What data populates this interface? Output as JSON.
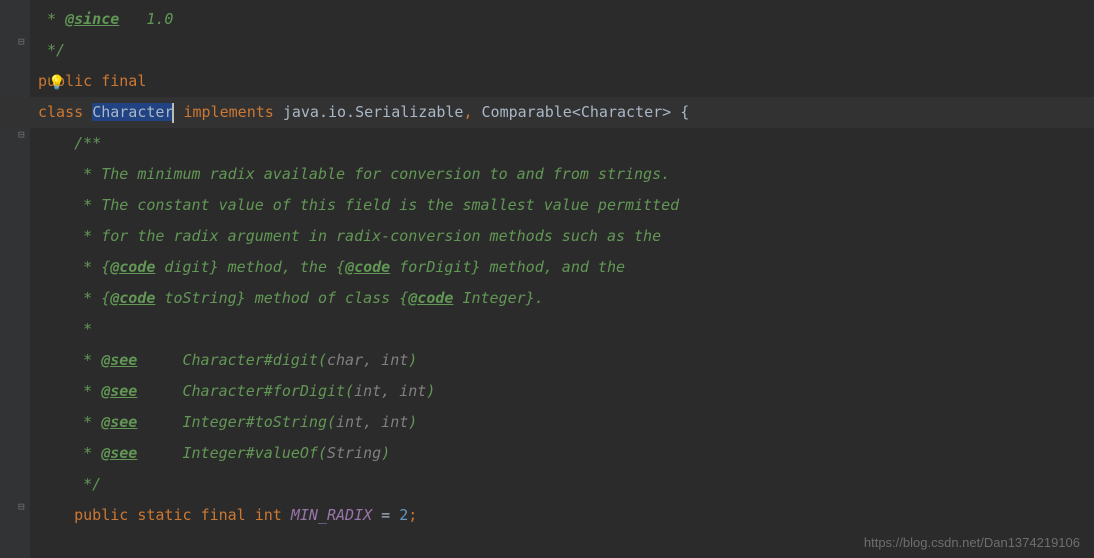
{
  "lines": {
    "l1_since": "@since",
    "l1_ver": "   1.0",
    "l2": " */",
    "l3_public": "public",
    "l3_final": "final",
    "l4_class": "class",
    "l4_character": "Character",
    "l4_implements": "implements",
    "l4_serial": "java.io.Serializable",
    "l4_comma": ",",
    "l4_comparable": "Comparable<Character> {",
    "l5": "    /**",
    "l6": "     * The minimum radix available for conversion to and from strings.",
    "l7": "     * The constant value of this field is the smallest value permitted",
    "l8": "     * for the radix argument in radix-conversion methods such as the",
    "l9_a": "     * {",
    "l9_code": "@code",
    "l9_b": " digit} method, the {",
    "l9_c": " forDigit} method, and the",
    "l10_a": "     * {",
    "l10_b": " toString} method of class {",
    "l10_c": " Integer}.",
    "l11": "     *",
    "l12_see": "@see",
    "l12_a": "     * ",
    "l12_sp": "     ",
    "l12_char": "Character",
    "l12_m": "#digit(",
    "l12_p": "char, int",
    "l12_e": ")",
    "l13_m": "#forDigit(",
    "l13_p": "int, int",
    "l14_int": "Integer",
    "l14_m": "#toString(",
    "l14_p": "int, int",
    "l15_m": "#valueOf(",
    "l15_p": "String",
    "l16": "     */",
    "l17_public": "public",
    "l17_static": "static",
    "l17_final": "final",
    "l17_int": "int",
    "l17_field": "MIN_RADIX",
    "l17_eq": " = ",
    "l17_val": "2",
    "l17_semi": ";"
  },
  "watermark": "https://blog.csdn.net/Dan1374219106"
}
